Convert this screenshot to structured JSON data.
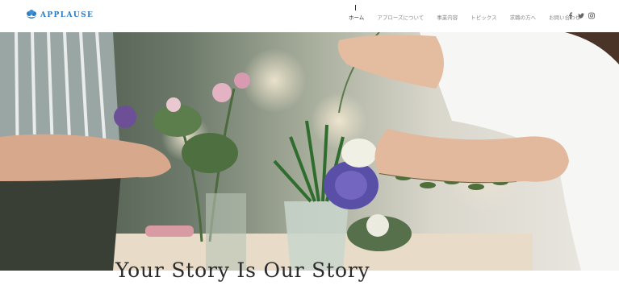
{
  "header": {
    "logo_text": "APPLAUSE",
    "nav": [
      {
        "label": "ホーム",
        "active": true
      },
      {
        "label": "アプローズについて",
        "active": false
      },
      {
        "label": "事業内容",
        "active": false
      },
      {
        "label": "トピックス",
        "active": false
      },
      {
        "label": "求職の方へ",
        "active": false
      },
      {
        "label": "お問い合わせ",
        "active": false
      }
    ],
    "social": [
      "facebook-icon",
      "twitter-icon",
      "instagram-icon"
    ]
  },
  "hero": {
    "tagline": "Your Story Is Our Story"
  },
  "colors": {
    "brand": "#2f7dc3",
    "nav_text": "#8a8a8a",
    "nav_active": "#333333",
    "tagline": "#2b2b2b"
  }
}
